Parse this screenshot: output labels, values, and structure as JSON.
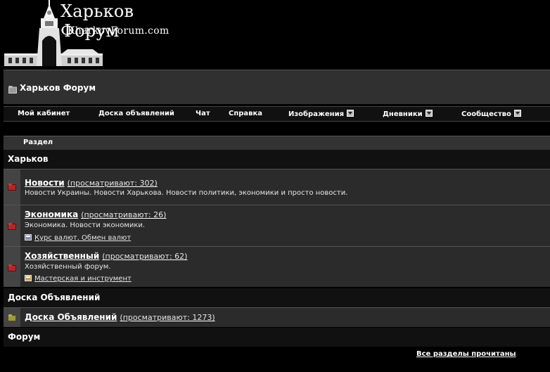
{
  "header": {
    "logo_title": "Харьков Форум",
    "logo_subtitle": "KharkovForum.com"
  },
  "breadcrumb": {
    "title": "Харьков Форум"
  },
  "nav": {
    "items": [
      {
        "label": "Мой кабинет",
        "dropdown": false
      },
      {
        "label": "Доска объявлений",
        "dropdown": false
      },
      {
        "label": "Чат",
        "dropdown": false
      },
      {
        "label": "Справка",
        "dropdown": false
      },
      {
        "label": "Изображения",
        "dropdown": true
      },
      {
        "label": "Дневники",
        "dropdown": true
      },
      {
        "label": "Сообщество",
        "dropdown": true
      }
    ]
  },
  "table": {
    "header": "Раздел"
  },
  "categories": [
    {
      "title": "Харьков",
      "forums": [
        {
          "name": "Новости",
          "viewing": "(просматривают: 302)",
          "description": "Новости Украины. Новости Харькова. Новости политики, экономики и просто новости.",
          "subforum": ""
        },
        {
          "name": "Экономика",
          "viewing": "(просматривают: 26)",
          "description": "Экономика. Новости экономики.",
          "subforum": "Курс валют. Обмен валют"
        },
        {
          "name": "Хозяйственный",
          "viewing": "(просматривают: 62)",
          "description": "Хозяйственный форум.",
          "subforum": "Мастерская и инструмент"
        }
      ]
    },
    {
      "title": "Доска Объявлений",
      "forums": [
        {
          "name": "Доска Объявлений",
          "viewing": "(просматривают: 1273)",
          "description": "",
          "subforum": ""
        }
      ]
    },
    {
      "title": "Форум",
      "forums": []
    }
  ],
  "footer": {
    "mark_read": "Все разделы прочитаны"
  },
  "colors": {
    "background": "#000000",
    "row": "#2b2b2b",
    "header_bar": "#303030",
    "folder_red": "#b02828",
    "folder_olive": "#9a9a40"
  }
}
